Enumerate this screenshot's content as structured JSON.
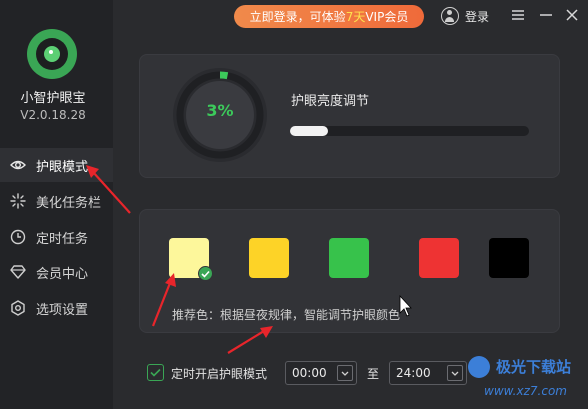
{
  "app": {
    "name": "小智护眼宝",
    "version": "V2.0.18.28"
  },
  "topbar": {
    "promo_before": "立即登录，可体验",
    "promo_highlight": "7天",
    "promo_after": "VIP会员",
    "login_label": "登录",
    "menu_icon": "menu-icon",
    "minimize_icon": "minimize-icon",
    "close_icon": "close-icon"
  },
  "sidebar": {
    "items": [
      {
        "label": "护眼模式",
        "icon": "eye-icon",
        "active": true
      },
      {
        "label": "美化任务栏",
        "icon": "sparkle-icon",
        "active": false
      },
      {
        "label": "定时任务",
        "icon": "clock-icon",
        "active": false
      },
      {
        "label": "会员中心",
        "icon": "diamond-icon",
        "active": false
      },
      {
        "label": "选项设置",
        "icon": "settings-icon",
        "active": false
      }
    ]
  },
  "brightness": {
    "percent_text": "3%",
    "percent_value": 3,
    "label": "护眼亮度调节",
    "slider_fraction": 0.16
  },
  "colors": {
    "swatches": [
      {
        "name": "light-yellow",
        "color": "#fdf79b",
        "selected": true
      },
      {
        "name": "yellow",
        "color": "#fdd327",
        "selected": false
      },
      {
        "name": "green",
        "color": "#37c24b",
        "selected": false
      },
      {
        "name": "red",
        "color": "#ee3333",
        "selected": false
      },
      {
        "name": "black",
        "color": "#000000",
        "selected": false
      }
    ],
    "recommend_text": "推荐色：根据昼夜规律，智能调节护眼颜色"
  },
  "schedule": {
    "enabled": true,
    "label": "定时开启护眼模式",
    "start_time": "00:00",
    "to_label": "至",
    "end_time": "24:00"
  },
  "watermark": {
    "title": "极光下载站",
    "url": "www.xz7.com"
  },
  "accent": "#3aa655",
  "gauge_color": "#3cc95b",
  "annotation_color": "#e8252b"
}
